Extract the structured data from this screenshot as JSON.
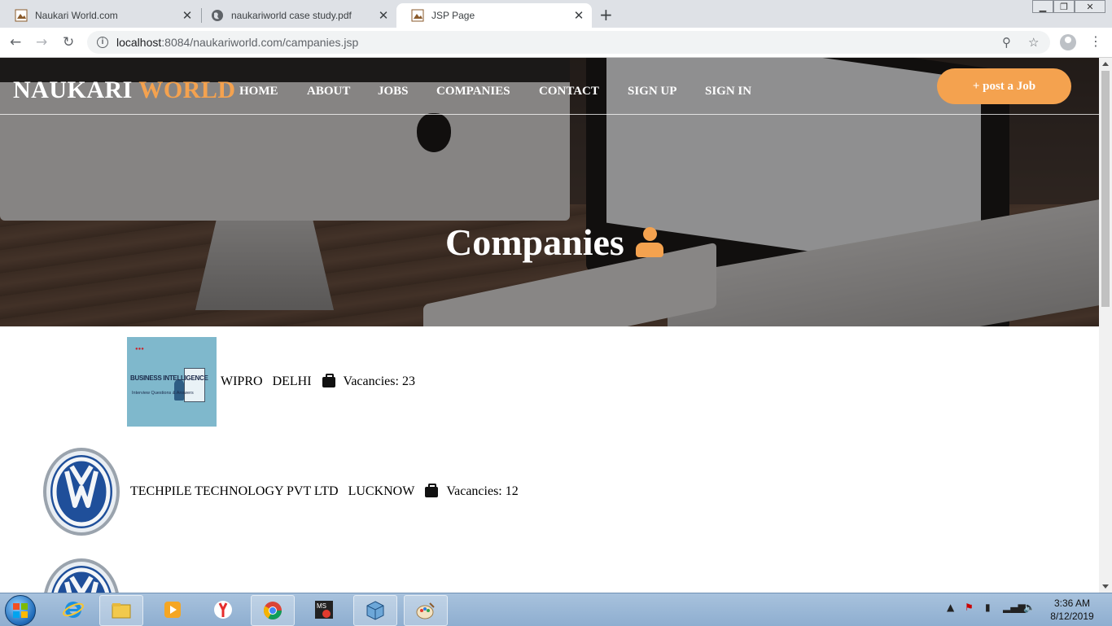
{
  "browser": {
    "tabs": [
      {
        "title": "Naukari World.com",
        "active": false
      },
      {
        "title": "naukariworld case study.pdf",
        "active": false
      },
      {
        "title": "JSP Page",
        "active": true
      }
    ],
    "url_host": "localhost",
    "url_rest": ":8084/naukariworld.com/campanies.jsp"
  },
  "site": {
    "brand_main": "NAUKARI",
    "brand_accent": "WORLD",
    "nav": [
      "HOME",
      "ABOUT",
      "JOBS",
      "COMPANIES",
      "CONTACT",
      "SIGN UP",
      "SIGN IN"
    ],
    "post_job_label": "+ post a Job",
    "page_title": "Companies",
    "accent_color": "#f4a24f"
  },
  "companies": [
    {
      "name": "WIPRO",
      "city": "DELHI",
      "vacancies": "Vacancies: 23",
      "logo": "business-intelligence-logo",
      "logo_text1": "BUSINESS INTELLIGENCE",
      "logo_text2": "Interview Questions & Answers"
    },
    {
      "name": "TECHPILE TECHNOLOGY PVT LTD",
      "city": "LUCKNOW",
      "vacancies": "Vacancies: 12",
      "logo": "volkswagen-logo"
    },
    {
      "name": "",
      "city": "",
      "vacancies": "",
      "logo": "volkswagen-logo"
    }
  ],
  "taskbar": {
    "time": "3:36 AM",
    "date": "8/12/2019",
    "apps": [
      "internet-explorer-icon",
      "file-explorer-icon",
      "media-player-icon",
      "yandex-icon",
      "chrome-icon",
      "ms-office-icon",
      "virtualbox-icon",
      "paint-icon"
    ]
  }
}
